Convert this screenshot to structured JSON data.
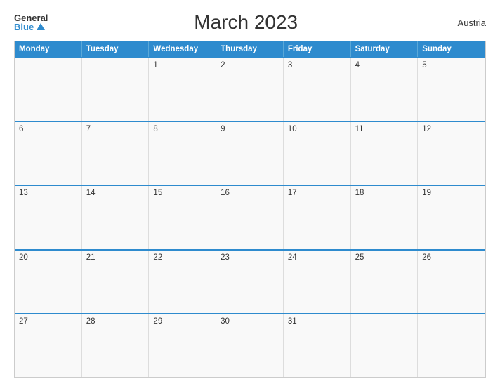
{
  "header": {
    "logo_general": "General",
    "logo_blue": "Blue",
    "title": "March 2023",
    "country": "Austria"
  },
  "weekdays": [
    "Monday",
    "Tuesday",
    "Wednesday",
    "Thursday",
    "Friday",
    "Saturday",
    "Sunday"
  ],
  "weeks": [
    [
      {
        "day": "",
        "empty": true
      },
      {
        "day": "",
        "empty": true
      },
      {
        "day": "1"
      },
      {
        "day": "2"
      },
      {
        "day": "3"
      },
      {
        "day": "4"
      },
      {
        "day": "5"
      }
    ],
    [
      {
        "day": "6"
      },
      {
        "day": "7"
      },
      {
        "day": "8"
      },
      {
        "day": "9"
      },
      {
        "day": "10"
      },
      {
        "day": "11"
      },
      {
        "day": "12"
      }
    ],
    [
      {
        "day": "13"
      },
      {
        "day": "14"
      },
      {
        "day": "15"
      },
      {
        "day": "16"
      },
      {
        "day": "17"
      },
      {
        "day": "18"
      },
      {
        "day": "19"
      }
    ],
    [
      {
        "day": "20"
      },
      {
        "day": "21"
      },
      {
        "day": "22"
      },
      {
        "day": "23"
      },
      {
        "day": "24"
      },
      {
        "day": "25"
      },
      {
        "day": "26"
      }
    ],
    [
      {
        "day": "27"
      },
      {
        "day": "28"
      },
      {
        "day": "29"
      },
      {
        "day": "30"
      },
      {
        "day": "31"
      },
      {
        "day": "",
        "empty": true
      },
      {
        "day": "",
        "empty": true
      }
    ]
  ]
}
